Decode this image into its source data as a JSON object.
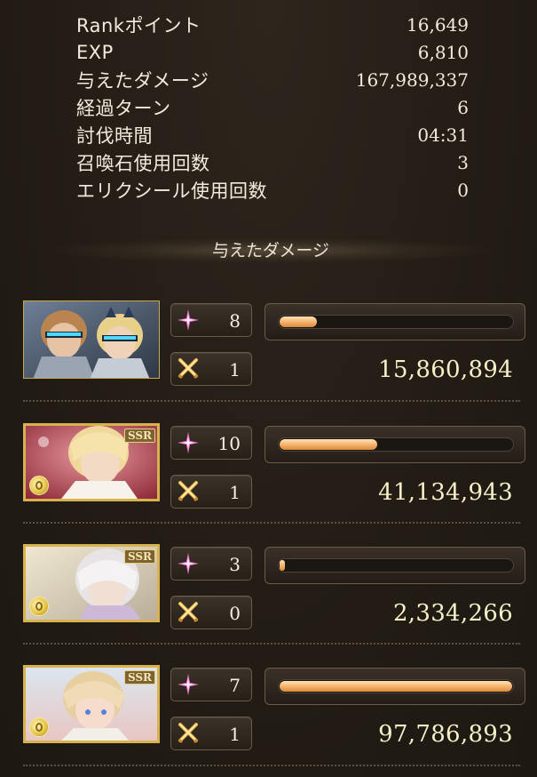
{
  "stats": [
    {
      "label": "Rankポイント",
      "value": "16,649"
    },
    {
      "label": "EXP",
      "value": "6,810"
    },
    {
      "label": "与えたダメージ",
      "value": "167,989,337"
    },
    {
      "label": "経過ターン",
      "value": "6"
    },
    {
      "label": "討伐時間",
      "value": "04:31"
    },
    {
      "label": "召喚石使用回数",
      "value": "3"
    },
    {
      "label": "エリクシール使用回数",
      "value": "0"
    }
  ],
  "section_title": "与えたダメージ",
  "characters": [
    {
      "ssr_label": "",
      "count_a": "8",
      "count_b": "1",
      "damage": "15,860,894",
      "damage_fraction": 0.162
    },
    {
      "ssr_label": "SSR",
      "count_a": "10",
      "count_b": "1",
      "damage": "41,134,943",
      "damage_fraction": 0.421
    },
    {
      "ssr_label": "SSR",
      "count_a": "3",
      "count_b": "0",
      "damage": "2,334,266",
      "damage_fraction": 0.024
    },
    {
      "ssr_label": "SSR",
      "count_a": "7",
      "count_b": "1",
      "damage": "97,786,893",
      "damage_fraction": 1.0
    }
  ],
  "icons": {
    "count_a": "pink-sparkle-icon",
    "count_b": "crossed-swords-icon",
    "element": "light-element-icon"
  },
  "colors": {
    "bar_fill": "#f4b06a",
    "damage_text": "#f4f0c8",
    "sparkle": "#ff7ad8",
    "frame_gold": "#d8b24e"
  }
}
